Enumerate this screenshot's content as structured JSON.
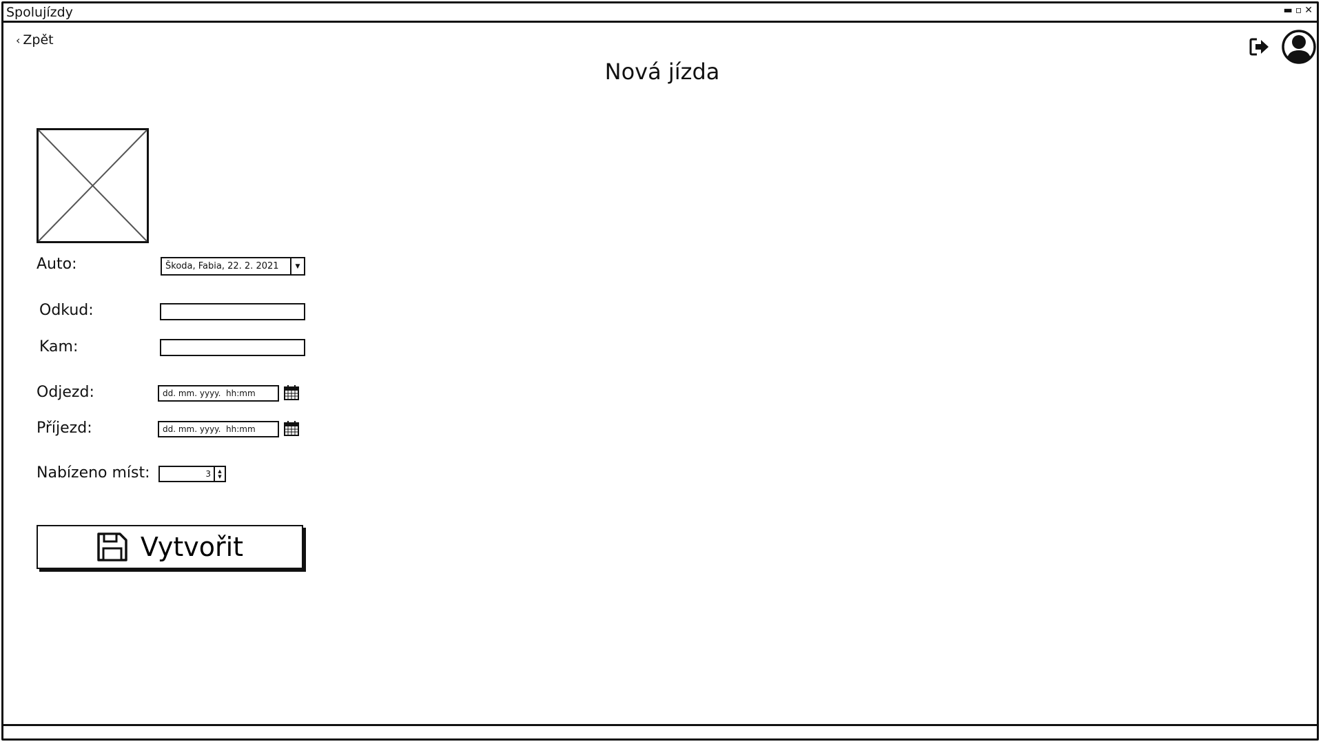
{
  "window": {
    "title": "Spolujízdy",
    "minimize_glyph": "▬",
    "maximize_glyph": "▫",
    "close_glyph": "✕"
  },
  "header": {
    "back_label": "Zpět",
    "back_icon": "chevron-left-icon",
    "logout_icon": "logout-icon",
    "avatar_icon": "user-avatar-icon"
  },
  "page": {
    "title": "Nová jízda"
  },
  "form": {
    "car_label": "Auto:",
    "car_value": "Škoda, Fabia, 22. 2. 2021",
    "from_label": "Odkud:",
    "from_value": "",
    "to_label": "Kam:",
    "to_value": "",
    "departure_label": "Odjezd:",
    "departure_placeholder": "dd. mm. yyyy.  hh:mm",
    "arrival_label": "Příjezd:",
    "arrival_placeholder": "dd. mm. yyyy.  hh:mm",
    "seats_label": "Nabízeno míst:",
    "seats_value": "3",
    "create_label": "Vytvořit",
    "create_icon": "save-icon"
  }
}
